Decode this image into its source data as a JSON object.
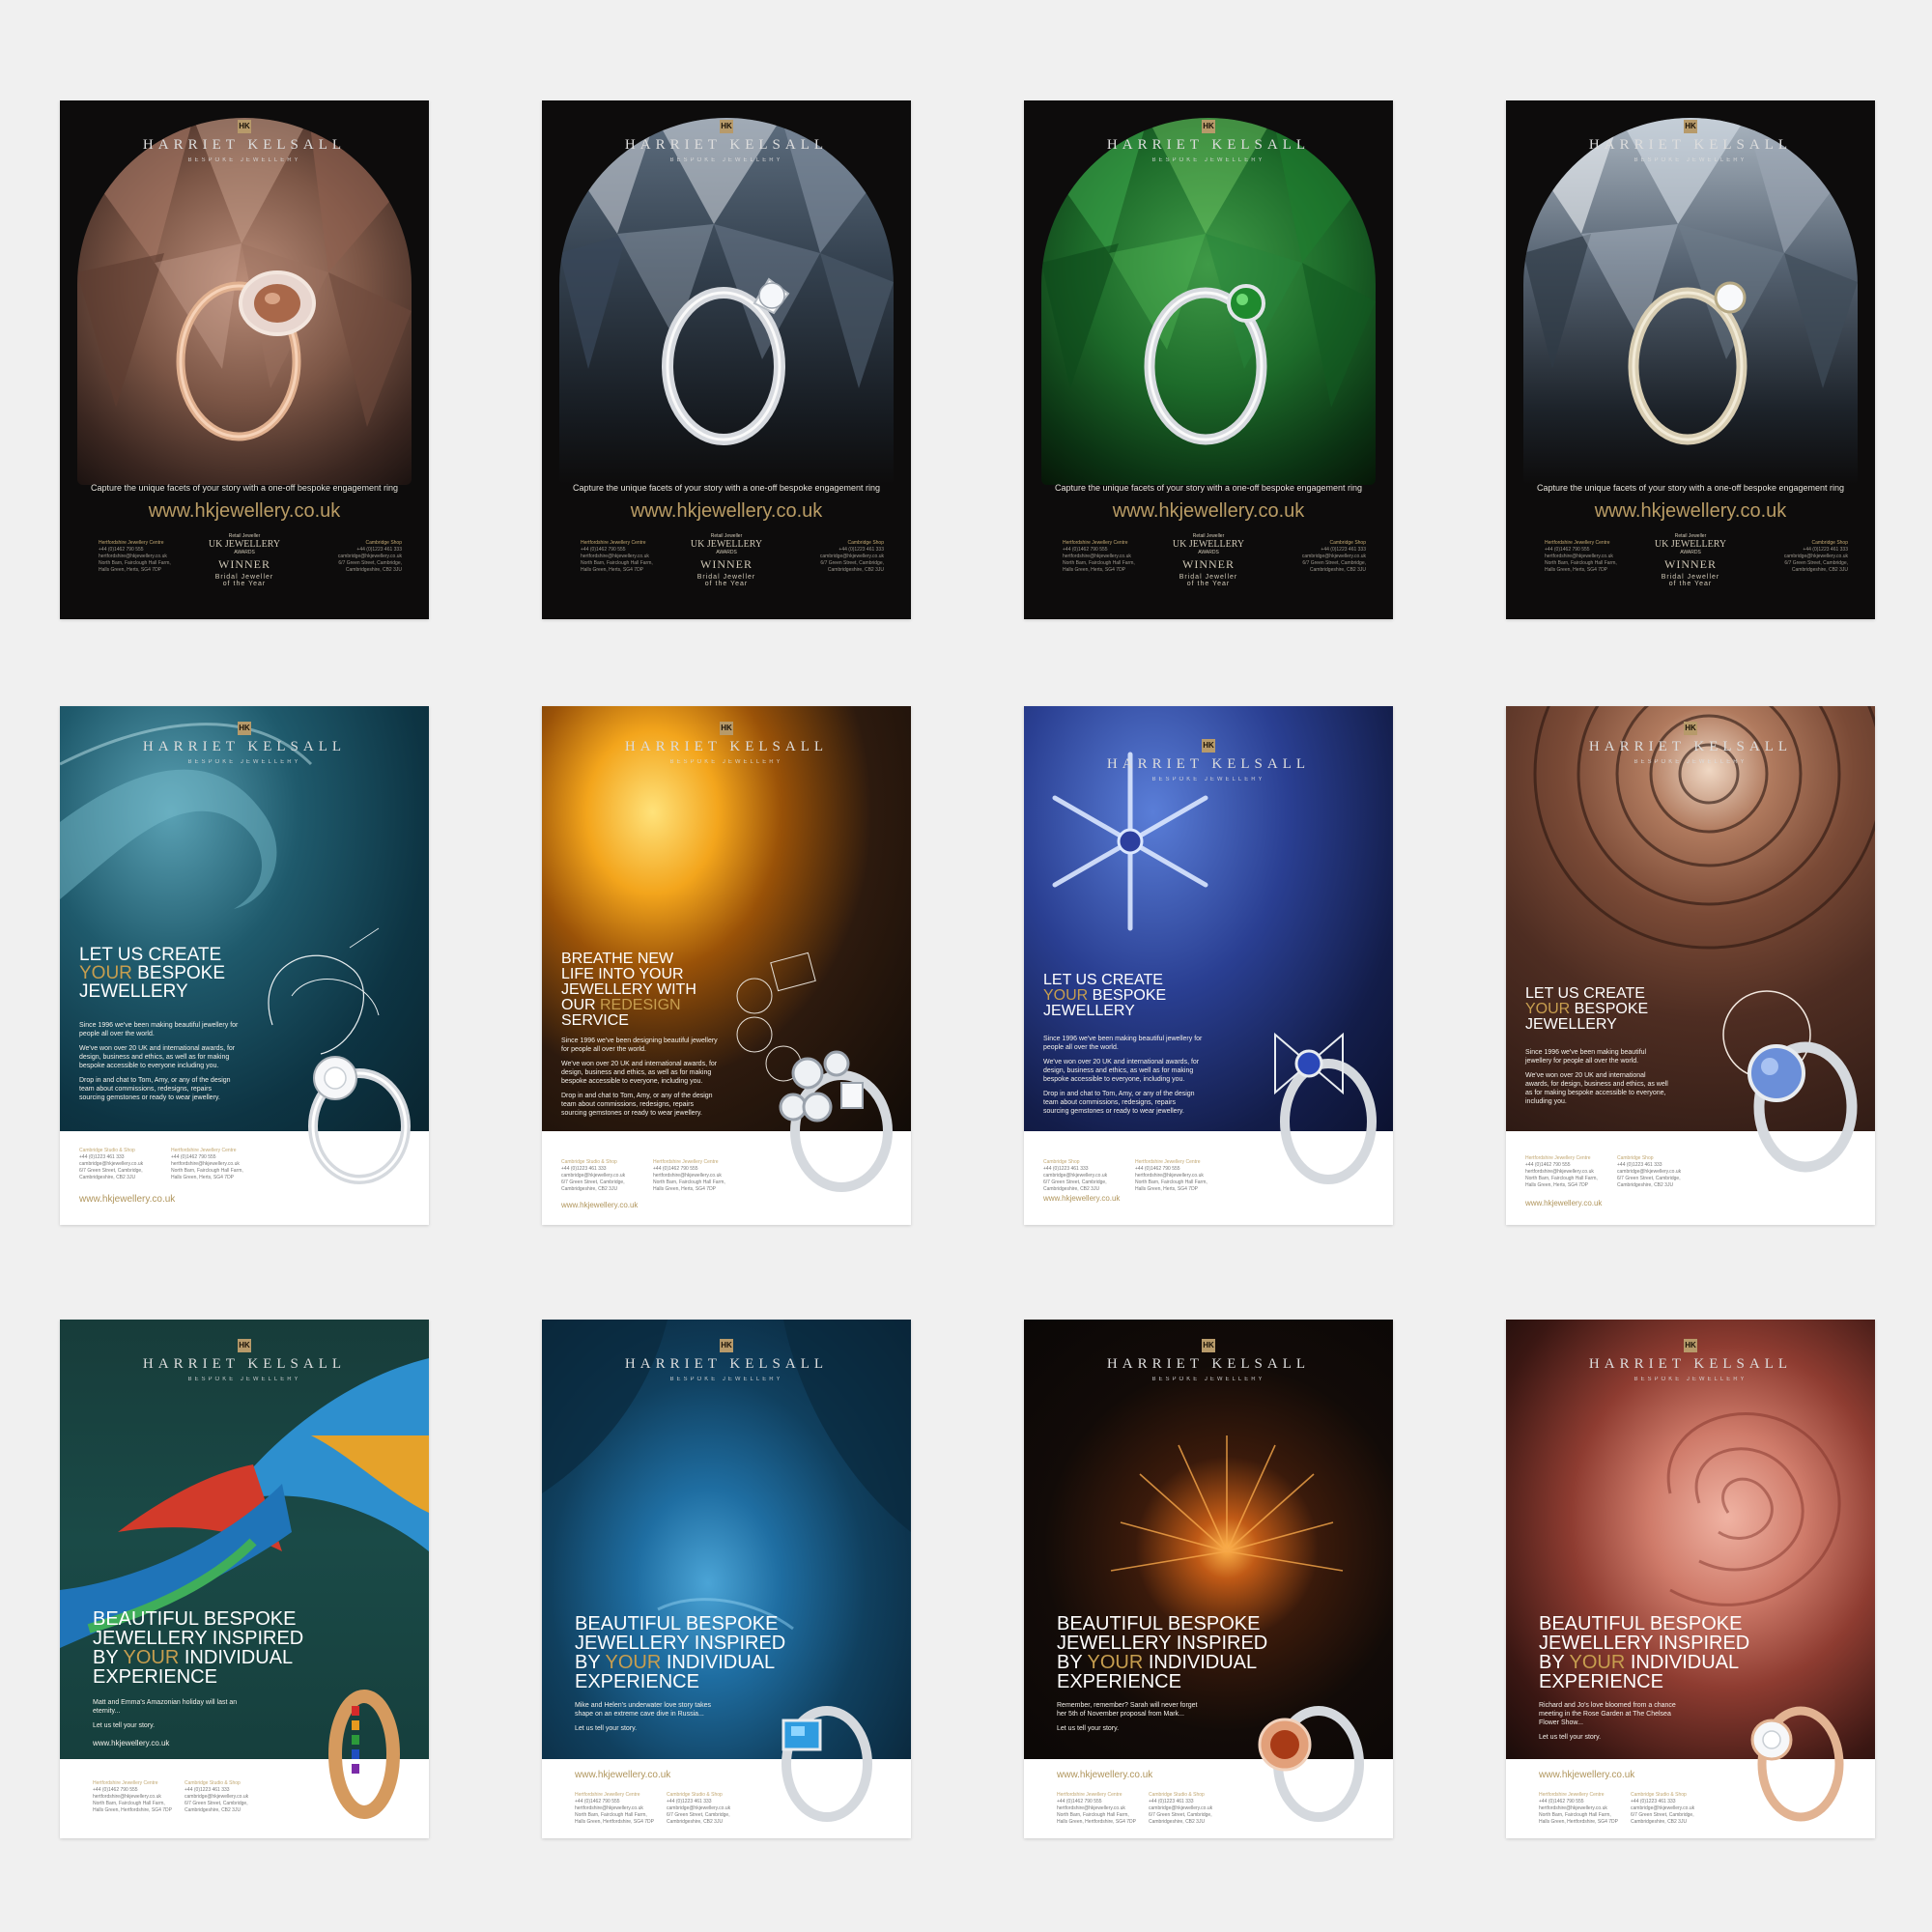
{
  "brand": {
    "name": "HARRIET KELSALL",
    "sub": "BESPOKE JEWELLERY",
    "mark": "HK"
  },
  "row1": {
    "tagline": "Capture the unique facets of your story with a one-off bespoke engagement ring",
    "url": "www.hkjewellery.co.uk",
    "award": {
      "line1": "Retail Jeweller",
      "line2": "UK JEWELLERY",
      "line3": "AWARDS",
      "line4": "WINNER",
      "line5": "Bridal Jeweller",
      "line6": "of the Year"
    },
    "left_address": {
      "heading": "Hertfordshire Jewellery Centre",
      "text": "+44 (0)1462 790 555\nhertfordshire@hkjewellery.co.uk\nNorth Barn, Fairclough Hall Farm,\nHalls Green, Herts, SG4 7DP"
    },
    "right_address": {
      "heading": "Cambridge Shop",
      "text": "+44 (0)1223 461 333\ncambridge@hkjewellery.co.uk\n6/7 Green Street, Cambridge,\nCambridgeshire, CB2 3JU"
    }
  },
  "row2": [
    {
      "head_a": "LET US CREATE",
      "head_y": "YOUR",
      "head_b": " BESPOKE",
      "head_c": "JEWELLERY",
      "body1": "Since 1996 we've been making beautiful jewellery for people all over the world.",
      "body2": "We've won over 20 UK and international awards, for design, business and ethics, as well as for making bespoke accessible to everyone including you.",
      "body3": "Drop in and chat to Tom, Amy, or any of the design team about commissions, redesigns, repairs sourcing gemstones or ready to wear jewellery.",
      "c1h": "Cambridge Studio & Shop",
      "c1": "+44 (0)1223 461 333\ncambridge@hkjewellery.co.uk\n6/7 Green Street, Cambridge,\nCambridgeshire, CB2 3JU",
      "c2h": "Hertfordshire Jewellery Centre",
      "c2": "+44 (0)1462 790 555\nhertfordshire@hkjewellery.co.uk\nNorth Barn, Fairclough Hall Farm,\nHalls Green, Herts, SG4 7DP",
      "url": "www.hkjewellery.co.uk"
    },
    {
      "head_a": "BREATHE NEW",
      "head_b": "LIFE INTO YOUR",
      "head_c": "JEWELLERY WITH",
      "head_d": "OUR ",
      "head_y": "REDESIGN",
      "head_e": "SERVICE",
      "body1": "Since 1996 we've been designing beautiful jewellery for people all over the world.",
      "body2": "We've won over 20 UK and international awards, for design, business and ethics, as well as for making bespoke accessible to everyone, including you.",
      "body3": "Drop in and chat to Tom, Amy, or any of the design team about commissions, redesigns, repairs sourcing gemstones or ready to wear jewellery.",
      "c1h": "Cambridge Studio & Shop",
      "c1": "+44 (0)1223 461 333\ncambridge@hkjewellery.co.uk\n6/7 Green Street, Cambridge,\nCambridgeshire, CB2 3JU",
      "c2h": "Hertfordshire Jewellery Centre",
      "c2": "+44 (0)1462 790 555\nhertfordshire@hkjewellery.co.uk\nNorth Barn, Fairclough Hall Farm,\nHalls Green, Herts, SG4 7DP",
      "url": "www.hkjewellery.co.uk"
    },
    {
      "head_a": "LET US CREATE",
      "head_y": "YOUR",
      "head_b": " BESPOKE",
      "head_c": "JEWELLERY",
      "body1": "Since 1996 we've been making beautiful jewellery for people all over the world.",
      "body2": "We've won over 20 UK and international awards, for design, business and ethics, as well as for making bespoke accessible to everyone, including you.",
      "body3": "Drop in and chat to Tom, Amy, or any of the design team about commissions, redesigns, repairs sourcing gemstones or ready to wear jewellery.",
      "c1h": "Cambridge Shop",
      "c1": "+44 (0)1223 461 333\ncambridge@hkjewellery.co.uk\n6/7 Green Street, Cambridge,\nCambridgeshire, CB2 3JU",
      "c2h": "Hertfordshire Jewellery Centre",
      "c2": "+44 (0)1462 790 555\nhertfordshire@hkjewellery.co.uk\nNorth Barn, Fairclough Hall Farm,\nHalls Green, Herts, SG4 7DP",
      "url": "www.hkjewellery.co.uk"
    },
    {
      "head_a": "LET US CREATE",
      "head_y": "YOUR",
      "head_b": " BESPOKE",
      "head_c": "JEWELLERY",
      "body1": "Since 1996 we've been making beautiful jewellery for people all over the world.",
      "body2": "We've won over 20 UK and international awards, for design, business and ethics, as well as for making bespoke accessible to everyone, including you.",
      "body3": "",
      "c1h": "Hertfordshire Jewellery Centre",
      "c1": "+44 (0)1462 790 555\nhertfordshire@hkjewellery.co.uk\nNorth Barn, Fairclough Hall Farm,\nHalls Green, Herts, SG4 7DP",
      "c2h": "Cambridge Shop",
      "c2": "+44 (0)1223 461 333\ncambridge@hkjewellery.co.uk\n6/7 Green Street, Cambridge,\nCambridgeshire, CB2 3JU",
      "url": "www.hkjewellery.co.uk"
    }
  ],
  "row3": {
    "head_a": "BEAUTIFUL BESPOKE",
    "head_b": "JEWELLERY INSPIRED",
    "head_c": "BY ",
    "head_y": "YOUR",
    "head_d": " INDIVIDUAL",
    "head_e": "EXPERIENCE",
    "cta": "Let us tell your story.",
    "url": "www.hkjewellery.co.uk",
    "c1h": "Hertfordshire Jewellery Centre",
    "c1": "+44 (0)1462 790 555\nhertfordshire@hkjewellery.co.uk\nNorth Barn, Fairclough Hall Farm,\nHalls Green, Hertfordshire, SG4 7DP",
    "c2h": "Cambridge Studio & Shop",
    "c2": "+44 (0)1223 461 333\ncambridge@hkjewellery.co.uk\n6/7 Green Street, Cambridge,\nCambridgeshire, CB2 3JU",
    "stories": [
      "Matt and Emma's Amazonian holiday will last an eternity...",
      "Mike and Helen's underwater love story takes shape on an extreme cave dive in Russia...",
      "Remember, remember? Sarah will never forget her 5th of November proposal from Mark...",
      "Richard and Jo's love bloomed from a chance meeting in the Rose Garden at The Chelsea Flower Show..."
    ]
  },
  "colors": {
    "background": "#f0f0f0",
    "gold": "#b99c65",
    "accent_your": "#c79e4f",
    "dark": "#0d0c0c"
  }
}
